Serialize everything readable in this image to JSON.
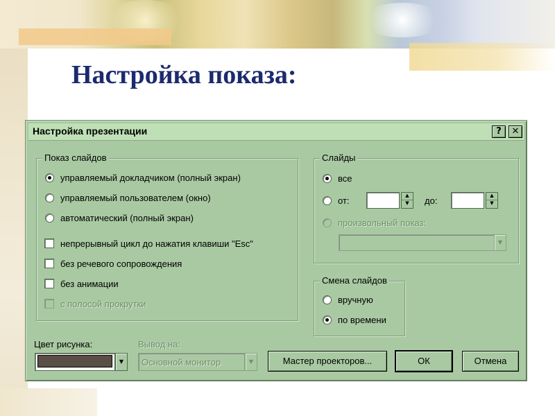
{
  "slide": {
    "title": "Настройка показа:"
  },
  "dialog": {
    "title": "Настройка презентации",
    "help_glyph": "?",
    "close_glyph": "✕",
    "show_group": {
      "legend": "Показ слайдов",
      "options": [
        {
          "label": "управляемый докладчиком (полный экран)",
          "selected": true
        },
        {
          "label": "управляемый пользователем (окно)",
          "selected": false
        },
        {
          "label": "автоматический (полный экран)",
          "selected": false
        }
      ],
      "checkboxes": [
        {
          "label": "непрерывный цикл до нажатия клавиши \"Esc\"",
          "checked": false,
          "enabled": true
        },
        {
          "label": "без речевого сопровождения",
          "checked": false,
          "enabled": true
        },
        {
          "label": "без анимации",
          "checked": false,
          "enabled": true
        },
        {
          "label": "с полосой прокрутки",
          "checked": false,
          "enabled": false
        }
      ]
    },
    "slides_group": {
      "legend": "Слайды",
      "all_label": "все",
      "from_label": "от:",
      "from_value": "",
      "to_label": "до:",
      "to_value": "",
      "custom_label": "произвольный показ:",
      "custom_value": ""
    },
    "advance_group": {
      "legend": "Смена слайдов",
      "manual_label": "вручную",
      "timings_label": "по времени"
    },
    "pen_color_label": "Цвет рисунка:",
    "pen_color": "#5a4e46",
    "output_label": "Вывод на:",
    "output_value": "Основной монитор",
    "projector_button": "Мастер проекторов...",
    "ok_button": "ОК",
    "cancel_button": "Отмена"
  }
}
